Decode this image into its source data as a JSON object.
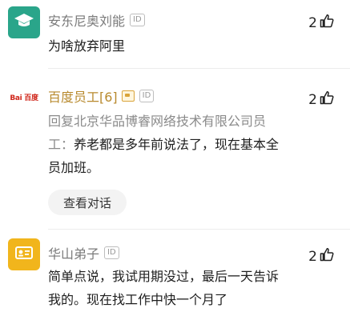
{
  "comments": [
    {
      "username": "安东尼奥刘能",
      "id_badge": "ID",
      "likes": "2",
      "text": "为啥放弃阿里",
      "avatar_color": "#2aa58a"
    },
    {
      "username": "百度员工[6]",
      "id_badge": "ID",
      "likes": "2",
      "avatar_logo": "Bai 百度",
      "reply_prefix": "回复北京华品博睿网络技术有限公司员工：",
      "text": "养老都是多年前说法了，现在基本全员加班。",
      "talk_button": "查看对话"
    },
    {
      "username": "华山弟子",
      "id_badge": "ID",
      "likes": "2",
      "text": "简单点说，我试用期没过，最后一天告诉我的。现在找工作中快一个月了",
      "avatar_color": "#f1b51c"
    }
  ]
}
